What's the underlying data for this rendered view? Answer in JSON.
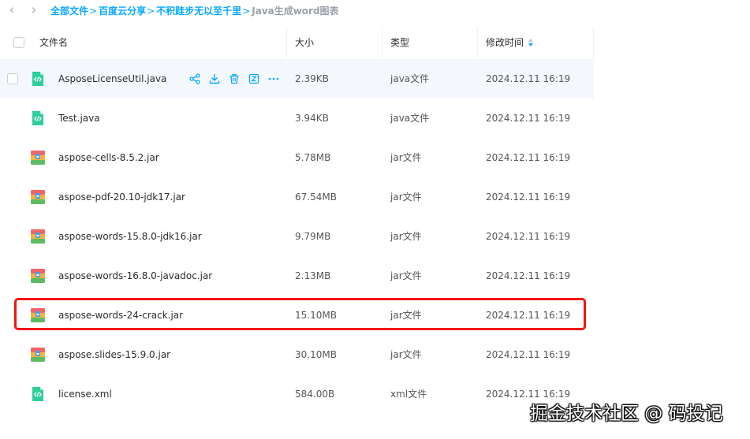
{
  "nav": {
    "back_icon": "chevron-left-icon",
    "forward_icon": "chevron-right-icon"
  },
  "breadcrumb": {
    "items": [
      "全部文件",
      "百度云分享",
      "不积跬步无以至千里",
      "Java生成word图表"
    ],
    "separator": ">"
  },
  "table": {
    "headers": {
      "name": "文件名",
      "size": "大小",
      "type": "类型",
      "modified": "修改时间"
    },
    "sort": {
      "column": "modified",
      "icon": "sort-icon"
    },
    "rows": [
      {
        "name": "AsposeLicenseUtil.java",
        "size": "2.39KB",
        "type": "java文件",
        "modified": "2024.12.11 16:19",
        "icon": "java-file-icon"
      },
      {
        "name": "Test.java",
        "size": "3.94KB",
        "type": "java文件",
        "modified": "2024.12.11 16:19",
        "icon": "java-file-icon"
      },
      {
        "name": "aspose-cells-8.5.2.jar",
        "size": "5.78MB",
        "type": "jar文件",
        "modified": "2024.12.11 16:19",
        "icon": "archive-file-icon"
      },
      {
        "name": "aspose-pdf-20.10-jdk17.jar",
        "size": "67.54MB",
        "type": "jar文件",
        "modified": "2024.12.11 16:19",
        "icon": "archive-file-icon"
      },
      {
        "name": "aspose-words-15.8.0-jdk16.jar",
        "size": "9.79MB",
        "type": "jar文件",
        "modified": "2024.12.11 16:19",
        "icon": "archive-file-icon"
      },
      {
        "name": "aspose-words-16.8.0-javadoc.jar",
        "size": "2.13MB",
        "type": "jar文件",
        "modified": "2024.12.11 16:19",
        "icon": "archive-file-icon"
      },
      {
        "name": "aspose-words-24-crack.jar",
        "size": "15.10MB",
        "type": "jar文件",
        "modified": "2024.12.11 16:19",
        "icon": "archive-file-icon"
      },
      {
        "name": "aspose.slides-15.9.0.jar",
        "size": "30.10MB",
        "type": "jar文件",
        "modified": "2024.12.11 16:19",
        "icon": "archive-file-icon"
      },
      {
        "name": "license.xml",
        "size": "584.00B",
        "type": "xml文件",
        "modified": "2024.12.11 16:19",
        "icon": "code-file-icon"
      }
    ]
  },
  "row_actions": [
    "share-icon",
    "download-icon",
    "delete-icon",
    "detail-icon",
    "more-icon"
  ],
  "highlight": {
    "row_index": 6,
    "color": "#f2160e"
  },
  "colors": {
    "accent": "#06a7ff",
    "hover_row": "#f4f8fd",
    "java_icon": "#2fce9c",
    "archive_icon_red": "#f06565"
  },
  "watermark": {
    "text": "掘金技术社区 @ 码投记"
  }
}
